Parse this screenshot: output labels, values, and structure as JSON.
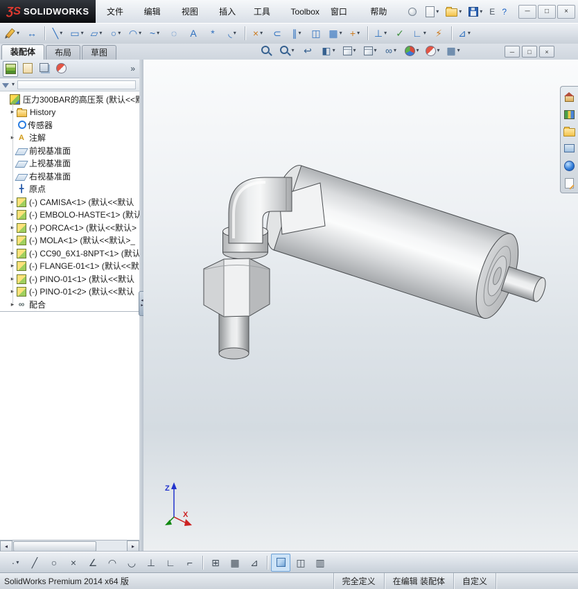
{
  "titlebar": {
    "brand_mark": "ƷS",
    "brand": "SOLIDWORKS",
    "menus": [
      "文件(F)",
      "编辑(E)",
      "视图(V)",
      "插入(I)",
      "工具(T)",
      "Toolbox",
      "窗口(W)",
      "帮助(H)"
    ],
    "quick_icons": [
      {
        "name": "new-document",
        "shape": "page",
        "dropdown": true
      },
      {
        "name": "open",
        "shape": "folder",
        "dropdown": true
      },
      {
        "name": "save",
        "shape": "floppy",
        "dropdown": true
      },
      {
        "name": "print",
        "glyph": "E",
        "color": "#4a5560"
      },
      {
        "name": "help",
        "glyph": "?",
        "color": "#1a62c5"
      }
    ],
    "window_buttons": [
      {
        "name": "minimize",
        "glyph": "─",
        "color": "#333"
      },
      {
        "name": "restore",
        "glyph": "□",
        "color": "#333"
      },
      {
        "name": "close",
        "glyph": "×",
        "color": "#333"
      }
    ]
  },
  "sketch_toolbar": {
    "icons": [
      {
        "name": "sketch",
        "shape": "pencil",
        "dropdown": true
      },
      {
        "name": "smart-dimension",
        "glyph": "↔",
        "color": "#2d6fbe"
      },
      {
        "sep": true
      },
      {
        "name": "line",
        "glyph": "╲",
        "color": "#2d6fbe",
        "dropdown": true
      },
      {
        "name": "corner-rectangle",
        "glyph": "▭",
        "color": "#2d6fbe",
        "dropdown": true
      },
      {
        "name": "straight-slot",
        "glyph": "▱",
        "color": "#2d6fbe",
        "dropdown": true
      },
      {
        "name": "circle",
        "glyph": "○",
        "color": "#2d6fbe",
        "dropdown": true
      },
      {
        "name": "centerpoint-arc",
        "glyph": "◠",
        "color": "#2d6fbe",
        "dropdown": true
      },
      {
        "name": "spline",
        "glyph": "~",
        "color": "#2d6fbe",
        "dropdown": true
      },
      {
        "name": "ellipse",
        "glyph": "◌",
        "color": "#2d6fbe"
      },
      {
        "name": "text",
        "glyph": "A",
        "color": "#2d6fbe"
      },
      {
        "name": "point",
        "glyph": "*",
        "color": "#2d6fbe"
      },
      {
        "name": "sketch-fillet",
        "glyph": "◟",
        "color": "#2d6fbe",
        "dropdown": true
      },
      {
        "sep": true
      },
      {
        "name": "trim-entities",
        "glyph": "×",
        "color": "#cd7a1e",
        "dropdown": true
      },
      {
        "name": "convert-entities",
        "glyph": "⊂",
        "color": "#2d6fbe"
      },
      {
        "name": "offset-entities",
        "glyph": "∥",
        "color": "#2d6fbe",
        "dropdown": true
      },
      {
        "name": "mirror-entities",
        "glyph": "◫",
        "color": "#2d6fbe"
      },
      {
        "name": "linear-sketch-pattern",
        "glyph": "▦",
        "color": "#2d6fbe",
        "dropdown": true
      },
      {
        "name": "move-entities",
        "glyph": "+",
        "color": "#cd7a1e",
        "dropdown": true
      },
      {
        "sep": true
      },
      {
        "name": "display-delete-relations",
        "glyph": "⊥",
        "color": "#2d6fbe",
        "dropdown": true
      },
      {
        "name": "repair-sketch",
        "glyph": "✓",
        "color": "#3f8f3f"
      },
      {
        "name": "quick-snaps",
        "glyph": "∟",
        "color": "#2d6fbe",
        "dropdown": true
      },
      {
        "name": "rapid-sketch",
        "glyph": "⚡",
        "color": "#cd7a1e"
      },
      {
        "sep": true
      },
      {
        "name": "instant2d",
        "glyph": "⊿",
        "color": "#2d6fbe",
        "dropdown": true
      }
    ]
  },
  "tab_bar": {
    "active": "装配体",
    "tabs": [
      {
        "name": "assembly",
        "label": "装配体"
      },
      {
        "name": "layout",
        "label": "布局"
      },
      {
        "name": "sketch",
        "label": "草图"
      }
    ]
  },
  "viewport": {
    "toolbar_icons": [
      {
        "name": "zoom-fit",
        "shape": "magnifier"
      },
      {
        "name": "zoom-area",
        "shape": "magnifier",
        "dropdown": true
      },
      {
        "name": "previous-view",
        "glyph": "↩",
        "color": "#35608f"
      },
      {
        "name": "section-view",
        "glyph": "◧",
        "color": "#35608f",
        "dropdown": true
      },
      {
        "name": "view-orientation",
        "shape": "cube",
        "dropdown": true
      },
      {
        "name": "display-style",
        "shape": "cube",
        "dropdown": true
      },
      {
        "name": "hide-show-items",
        "glyph": "∞",
        "color": "#35608f",
        "dropdown": true
      },
      {
        "name": "edit-appearance",
        "shape": "ball",
        "dropdown": true
      },
      {
        "name": "apply-scene",
        "shape": "ball-rb",
        "dropdown": true
      },
      {
        "name": "view-settings",
        "glyph": "▦",
        "color": "#35608f",
        "dropdown": true
      }
    ],
    "window_buttons": [
      {
        "name": "doc-minimize",
        "glyph": "─",
        "color": "#333"
      },
      {
        "name": "doc-restore",
        "glyph": "□",
        "color": "#333"
      },
      {
        "name": "doc-close",
        "glyph": "×",
        "color": "#333"
      }
    ],
    "triad": {
      "x_label": "X",
      "z_label": "Z"
    }
  },
  "taskpane": {
    "icons": [
      {
        "name": "home",
        "shape": "house"
      },
      {
        "name": "design-library",
        "shape": "library"
      },
      {
        "name": "file-explorer",
        "shape": "folder"
      },
      {
        "name": "view-palette",
        "shape": "palette"
      },
      {
        "name": "appearances-scenes",
        "shape": "globe"
      },
      {
        "name": "custom-properties",
        "shape": "pencilpad"
      }
    ]
  },
  "panel": {
    "toolbar_icons": [
      {
        "name": "featuremanager-design-tree",
        "shape": "fmtree",
        "selected": true
      },
      {
        "name": "propertymanager",
        "shape": "pmclip"
      },
      {
        "name": "configurationmanager",
        "shape": "cfg"
      },
      {
        "name": "displaymanager",
        "shape": "ball-rb"
      }
    ],
    "chevron": "»",
    "tree": {
      "root": {
        "label": "压力300BAR的高压泵 (默认<<默认",
        "icon": "assembly"
      },
      "items": [
        {
          "label": "History",
          "icon": "history",
          "expand": true
        },
        {
          "label": "传感器",
          "icon": "sensors"
        },
        {
          "label": "注解",
          "icon": "annotations",
          "glyph": "A",
          "expand": true
        },
        {
          "label": "前视基准面",
          "icon": "plane"
        },
        {
          "label": "上视基准面",
          "icon": "plane"
        },
        {
          "label": "右视基准面",
          "icon": "plane"
        },
        {
          "label": "原点",
          "icon": "origin",
          "glyph": "╋"
        },
        {
          "label": "(-) CAMISA<1> (默认<<默认",
          "icon": "part",
          "expand": true
        },
        {
          "label": "(-) EMBOLO-HASTE<1> (默认",
          "icon": "part",
          "expand": true
        },
        {
          "label": "(-) PORCA<1> (默认<<默认>",
          "icon": "part",
          "expand": true
        },
        {
          "label": "(-) MOLA<1> (默认<<默认>_",
          "icon": "part",
          "expand": true
        },
        {
          "label": "(-) CC90_6X1-8NPT<1> (默认",
          "icon": "part",
          "expand": true
        },
        {
          "label": "(-) FLANGE-01<1> (默认<<默",
          "icon": "part",
          "expand": true
        },
        {
          "label": "(-) PINO-01<1> (默认<<默认",
          "icon": "part",
          "expand": true
        },
        {
          "label": "(-) PINO-01<2> (默认<<默认",
          "icon": "part",
          "expand": true
        },
        {
          "label": "配合",
          "icon": "mates",
          "glyph": "∞",
          "expand": true
        }
      ]
    }
  },
  "bottom_toolbar": {
    "icons": [
      {
        "name": "point-filter",
        "glyph": "·",
        "color": "#3f4a55",
        "dropdown": true
      },
      {
        "name": "line-filter",
        "glyph": "╱",
        "color": "#3f4a55"
      },
      {
        "name": "circle-filter",
        "glyph": "○",
        "color": "#3f4a55"
      },
      {
        "name": "intersection-snap",
        "glyph": "×",
        "color": "#3f4a55"
      },
      {
        "name": "angle-snap",
        "glyph": "∠",
        "color": "#3f4a55"
      },
      {
        "name": "nearest-snap",
        "glyph": "◠",
        "color": "#3f4a55"
      },
      {
        "name": "tangent-snap",
        "glyph": "◡",
        "color": "#3f4a55"
      },
      {
        "name": "perpendicular-snap",
        "glyph": "⊥",
        "color": "#3f4a55"
      },
      {
        "name": "h-v-snap",
        "glyph": "∟",
        "color": "#3f4a55"
      },
      {
        "name": "grid-snap",
        "glyph": "⌐",
        "color": "#3f4a55"
      },
      {
        "sep": true
      },
      {
        "name": "grid-settings",
        "glyph": "⊞",
        "color": "#3f4a55"
      },
      {
        "name": "length-snap",
        "glyph": "▦",
        "color": "#3f4a55"
      },
      {
        "name": "angle-grid",
        "glyph": "⊿",
        "color": "#3f4a55"
      },
      {
        "sep": true
      },
      {
        "name": "shaded-with-edges",
        "shape": "cube-blue",
        "selected": true
      },
      {
        "name": "hidden-lines-visible",
        "glyph": "◫",
        "color": "#3f4a55"
      },
      {
        "name": "wireframe",
        "glyph": "▥",
        "color": "#3f4a55"
      }
    ]
  },
  "statusbar": {
    "product": "SolidWorks Premium 2014 x64 版",
    "fields": [
      "完全定义",
      "在编辑 装配体",
      "自定义"
    ]
  }
}
